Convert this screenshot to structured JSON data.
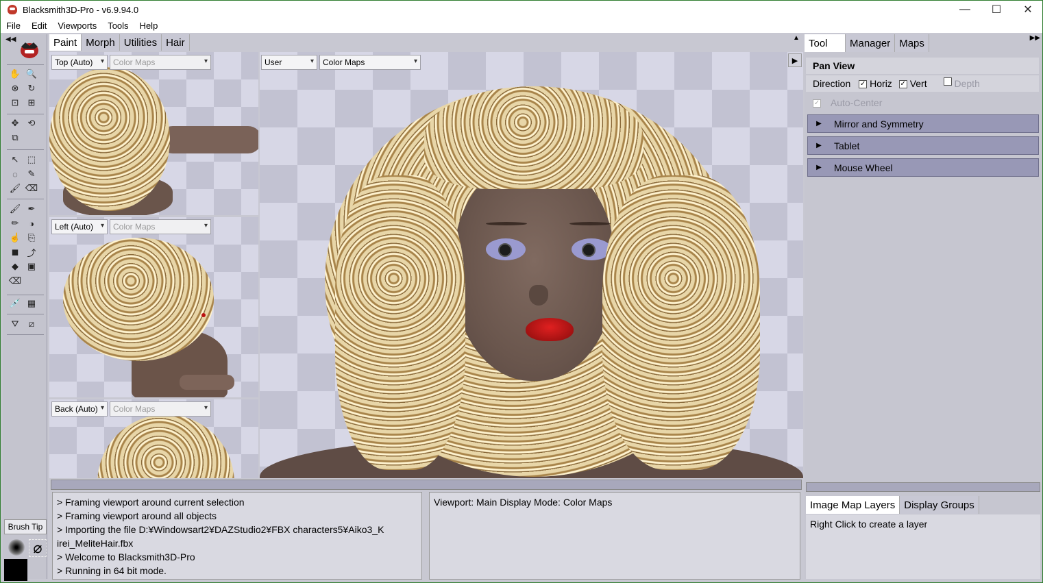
{
  "window": {
    "title": "Blacksmith3D-Pro - v6.9.94.0",
    "min": "—",
    "max": "☐",
    "close": "✕"
  },
  "menu": [
    "File",
    "Edit",
    "Viewports",
    "Tools",
    "Help"
  ],
  "toolbox": {
    "brush_tip_label": "Brush Tip",
    "colors": {
      "primary": "#000000"
    }
  },
  "main_tabs": [
    "Paint",
    "Morph",
    "Utilities",
    "Hair"
  ],
  "viewports": {
    "top": {
      "view": "Top (Auto)",
      "mode": "Color Maps"
    },
    "left": {
      "view": "Left (Auto)",
      "mode": "Color Maps"
    },
    "back": {
      "view": "Back (Auto)",
      "mode": "Color Maps"
    },
    "main": {
      "view": "User",
      "mode": "Color Maps"
    }
  },
  "log": {
    "lines": [
      "> Framing viewport around current selection",
      "> Framing viewport around all objects",
      "> Importing the file D:¥Windowsart2¥DAZStudio2¥FBX characters5¥Aiko3_K",
      "irei_MeliteHair.fbx",
      "> Welcome to Blacksmith3D-Pro",
      "> Running in 64 bit mode."
    ],
    "status": "Viewport: Main Display Mode: Color Maps"
  },
  "right_panel": {
    "tabs": [
      "Tool",
      "Manager",
      "Maps"
    ],
    "tool_title": "Pan View",
    "direction_label": "Direction",
    "horiz_label": "Horiz",
    "vert_label": "Vert",
    "depth_label": "Depth",
    "auto_center_label": "Auto-Center",
    "sections": [
      "Mirror and Symmetry",
      "Tablet",
      "Mouse Wheel"
    ],
    "bottom_tabs": [
      "Image Map Layers",
      "Display Groups"
    ],
    "layers_hint": "Right Click to create a layer"
  }
}
